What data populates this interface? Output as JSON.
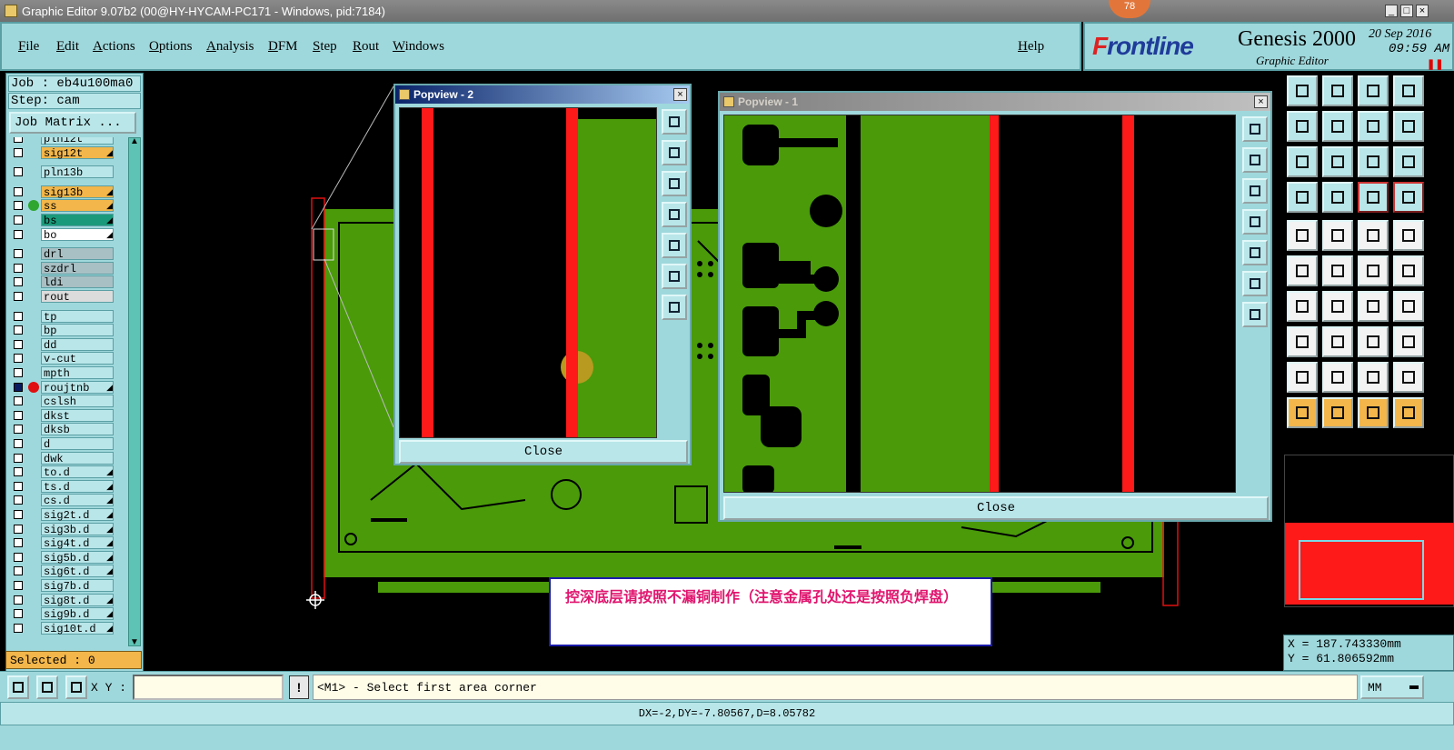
{
  "window": {
    "title": "Graphic Editor 9.07b2 (00@HY-HYCAM-PC171 - Windows, pid:7184)",
    "badge": "78"
  },
  "menu": {
    "items": [
      "File",
      "Edit",
      "Actions",
      "Options",
      "Analysis",
      "DFM",
      "Step",
      "Rout",
      "Windows"
    ],
    "help": "Help"
  },
  "brand": {
    "logo": "Frontline",
    "product": "Genesis 2000",
    "subtitle": "Graphic Editor",
    "date": "20 Sep 2016",
    "time": "09:59 AM"
  },
  "job": {
    "job_line": "Job : eb4u100ma0",
    "step_line": "Step: cam",
    "matrix_button": "Job Matrix ..."
  },
  "layers": [
    {
      "name": "pln12t",
      "color": "#b9e6e9"
    },
    {
      "name": "sig12t",
      "color": "#f2b64a",
      "mark": true
    },
    {
      "name": "pln13b",
      "color": "#b9e6e9"
    },
    {
      "name": "sig13b",
      "color": "#f2b64a",
      "mark": true
    },
    {
      "name": "ss",
      "color": "#f2b64a",
      "dot": "#2fa62f",
      "mark": true
    },
    {
      "name": "bs",
      "color": "#1a9a7a",
      "mark": true
    },
    {
      "name": "bo",
      "color": "#ffffff",
      "mark": true
    },
    {
      "name": "drl",
      "color": "#a8c0c4"
    },
    {
      "name": "szdrl",
      "color": "#a8c0c4"
    },
    {
      "name": "ldi",
      "color": "#a8c0c4"
    },
    {
      "name": "rout",
      "color": "#dcdcdc"
    },
    {
      "name": "tp",
      "color": "#b9e6e9"
    },
    {
      "name": "bp",
      "color": "#b9e6e9"
    },
    {
      "name": "dd",
      "color": "#b9e6e9"
    },
    {
      "name": "v-cut",
      "color": "#b9e6e9"
    },
    {
      "name": "mpth",
      "color": "#b9e6e9"
    },
    {
      "name": "roujtnb",
      "color": "#b9e6e9",
      "dot": "#e01010",
      "active": true,
      "mark": true
    },
    {
      "name": "cslsh",
      "color": "#b9e6e9"
    },
    {
      "name": "dkst",
      "color": "#b9e6e9"
    },
    {
      "name": "dksb",
      "color": "#b9e6e9"
    },
    {
      "name": "d",
      "color": "#b9e6e9"
    },
    {
      "name": "dwk",
      "color": "#b9e6e9"
    },
    {
      "name": "to.d",
      "color": "#b9e6e9",
      "mark": true
    },
    {
      "name": "ts.d",
      "color": "#b9e6e9",
      "mark": true
    },
    {
      "name": "cs.d",
      "color": "#b9e6e9",
      "mark": true
    },
    {
      "name": "sig2t.d",
      "color": "#b9e6e9",
      "mark": true
    },
    {
      "name": "sig3b.d",
      "color": "#b9e6e9",
      "mark": true
    },
    {
      "name": "sig4t.d",
      "color": "#b9e6e9",
      "mark": true
    },
    {
      "name": "sig5b.d",
      "color": "#b9e6e9",
      "mark": true
    },
    {
      "name": "sig6t.d",
      "color": "#b9e6e9",
      "mark": true
    },
    {
      "name": "sig7b.d",
      "color": "#b9e6e9"
    },
    {
      "name": "sig8t.d",
      "color": "#b9e6e9",
      "mark": true
    },
    {
      "name": "sig9b.d",
      "color": "#b9e6e9",
      "mark": true
    },
    {
      "name": "sig10t.d",
      "color": "#b9e6e9",
      "mark": true
    }
  ],
  "selected": "Selected : 0",
  "popview2": {
    "title": "Popview - 2",
    "close": "Close"
  },
  "popview1": {
    "title": "Popview - 1",
    "close": "Close"
  },
  "note": "控深底层请按照不漏铜制作（注意金属孔处还是按照负焊盘）",
  "coords": {
    "x": "X = 187.743330mm",
    "y": "Y = 61.806592mm"
  },
  "bottom": {
    "xy_label": "X Y :",
    "xy_value": "",
    "message": "<M1> - Select first area corner",
    "units": "MM",
    "status": "DX=-2,DY=-7.80567,D=8.05782"
  },
  "colors": {
    "copper": "#4a9a0a",
    "highlight": "#ff1a1a",
    "panel": "#9fd8dc"
  }
}
